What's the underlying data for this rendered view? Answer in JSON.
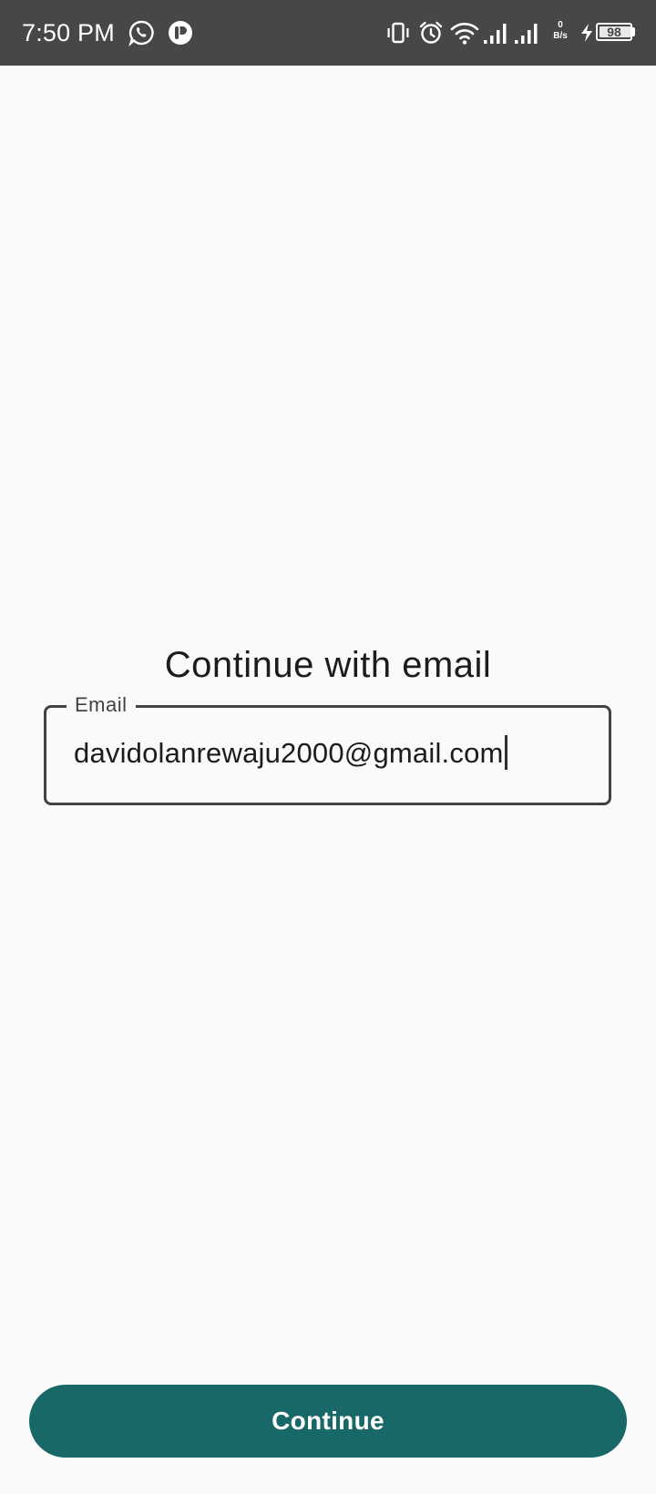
{
  "status_bar": {
    "time": "7:50 PM",
    "net_speed_value": "0",
    "net_speed_unit": "B/s",
    "battery_level": "98",
    "icons_left": [
      "whatsapp-icon",
      "app-notification-icon"
    ],
    "icons_right": [
      "vibrate-icon",
      "alarm-icon",
      "wifi-icon",
      "signal-icon",
      "signal-icon",
      "charging-icon",
      "battery-icon"
    ]
  },
  "main": {
    "title": "Continue with email",
    "email_field": {
      "label": "Email",
      "value": "davidolanrewaju2000@gmail.com"
    },
    "continue_button": {
      "label": "Continue"
    }
  },
  "colors": {
    "status_bar_bg": "#474747",
    "page_bg": "#fafafa",
    "primary_button": "#186868",
    "field_border": "#424242"
  }
}
